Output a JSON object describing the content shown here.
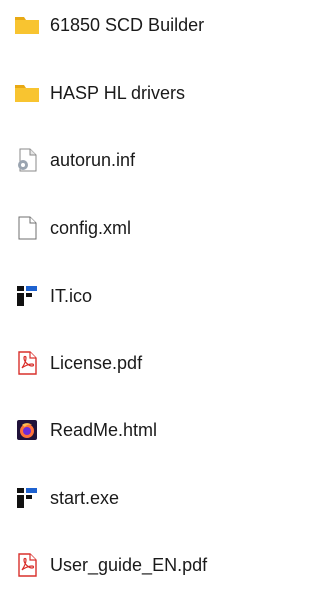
{
  "files": [
    {
      "name": "61850 SCD Builder",
      "icon": "folder-icon"
    },
    {
      "name": "HASP HL drivers",
      "icon": "folder-icon"
    },
    {
      "name": "autorun.inf",
      "icon": "settings-file-icon"
    },
    {
      "name": "config.xml",
      "icon": "blank-file-icon"
    },
    {
      "name": "IT.ico",
      "icon": "app-logo-icon"
    },
    {
      "name": "License.pdf",
      "icon": "pdf-icon"
    },
    {
      "name": "ReadMe.html",
      "icon": "firefox-icon"
    },
    {
      "name": "start.exe",
      "icon": "app-logo-icon"
    },
    {
      "name": "User_guide_EN.pdf",
      "icon": "pdf-icon"
    }
  ],
  "colors": {
    "folder": "#F8C430",
    "folder_tab": "#E8A914",
    "pdf_red": "#D9302C",
    "app_black": "#111111",
    "app_blue": "#1E62D0",
    "text": "#1A1A1A"
  }
}
